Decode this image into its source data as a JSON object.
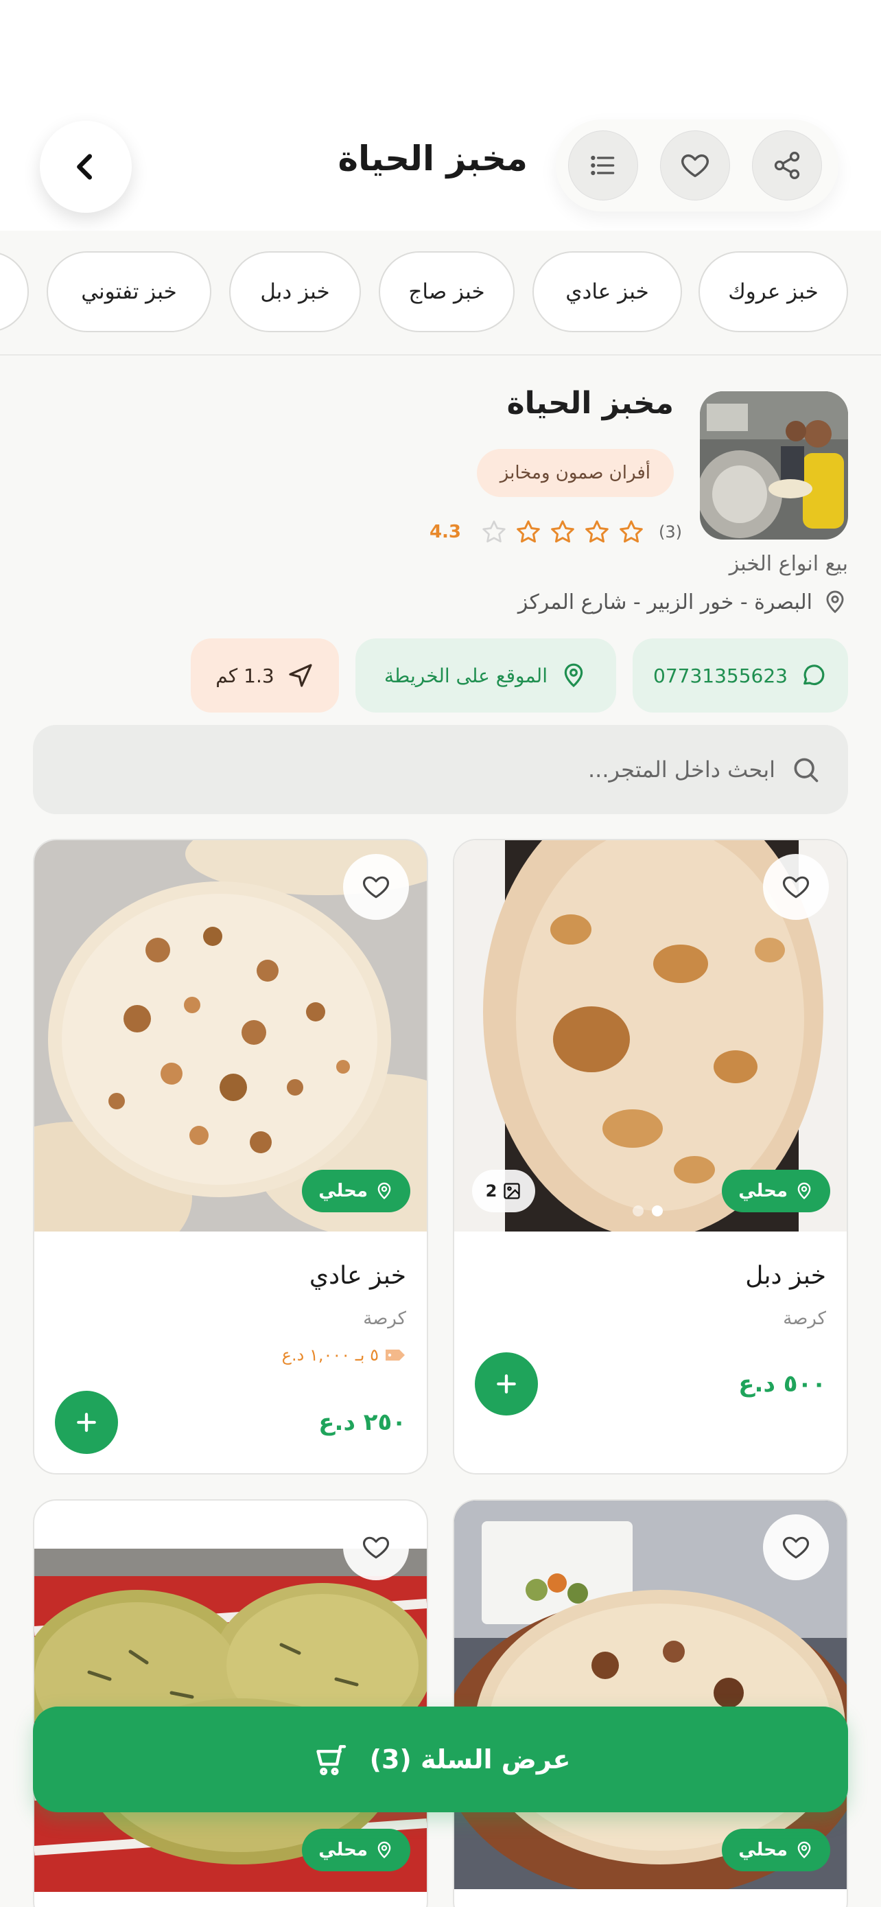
{
  "header": {
    "title": "مخبز الحياة",
    "back_icon": "chevron-left-icon",
    "actions": [
      {
        "name": "share",
        "icon": "share-icon"
      },
      {
        "name": "favorite",
        "icon": "heart-icon"
      },
      {
        "name": "menu",
        "icon": "list-icon"
      }
    ]
  },
  "categories": [
    "خبز عروك",
    "خبز عادي",
    "خبز صاج",
    "خبز دبل",
    "خبز تفتوني"
  ],
  "store": {
    "name": "مخبز الحياة",
    "category": "أفران صمون ومخابز",
    "rating": "4.3",
    "rating_value": 4.3,
    "rating_count": "(3)",
    "description": "بيع انواع الخبز",
    "address": "البصرة - خور الزبير - شارع المركز",
    "phone": "07731355623",
    "map_label": "الموقع على الخريطة",
    "distance": "1.3 كم"
  },
  "search": {
    "placeholder": "ابحث داخل المتجر..."
  },
  "products": [
    {
      "name": "خبز دبل",
      "unit": "كرصة",
      "price": "٥٠٠ د.ع",
      "badge": "محلي",
      "image_count": "2",
      "offer": ""
    },
    {
      "name": "خبز عادي",
      "unit": "كرصة",
      "price": "٢٥٠ د.ع",
      "badge": "محلي",
      "image_count": "",
      "offer": "٥ بـ ١,٠٠٠ د.ع"
    },
    {
      "name": "",
      "unit": "",
      "price": "",
      "badge": "محلي",
      "image_count": "",
      "offer": ""
    },
    {
      "name": "",
      "unit": "",
      "price": "",
      "badge": "محلي",
      "image_count": "",
      "offer": ""
    }
  ],
  "cart": {
    "label": "عرض السلة (3)",
    "icon": "cart-icon"
  },
  "colors": {
    "primary": "#1fa45b",
    "accent": "#e8892b",
    "background": "#f8f8f6"
  }
}
